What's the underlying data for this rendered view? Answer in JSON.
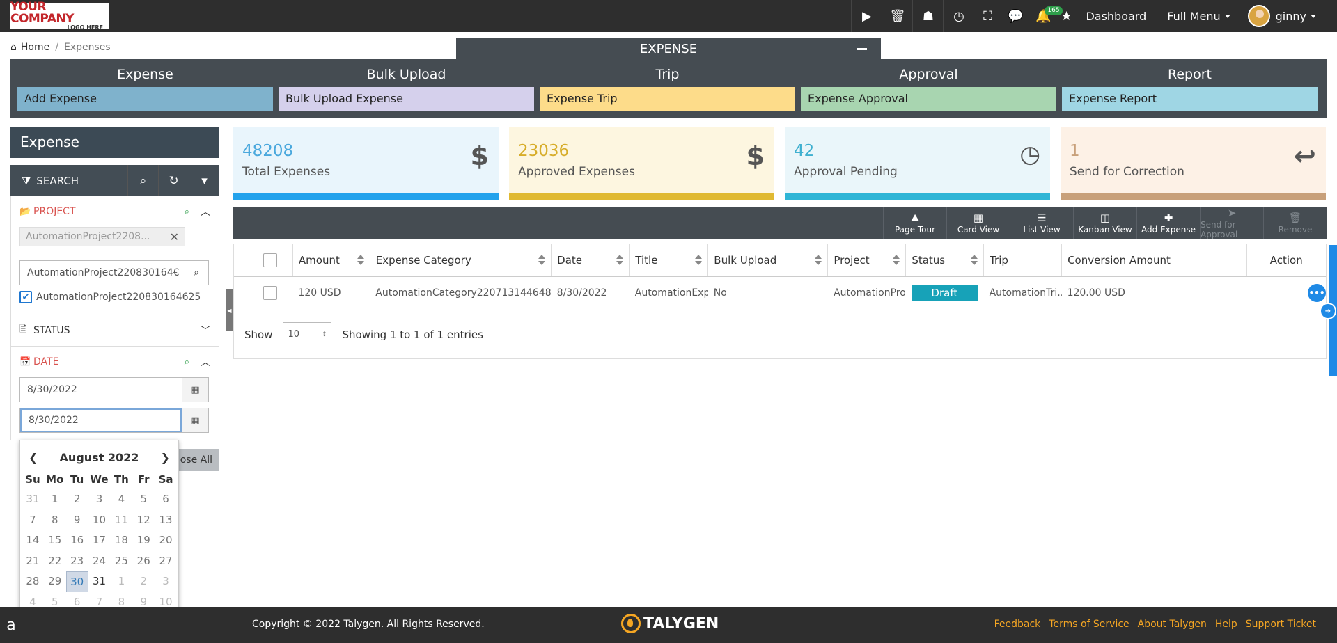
{
  "logo": {
    "line1": "YOUR COMPANY",
    "line2": "LOGO HERE"
  },
  "topnav": {
    "notification_count": "165",
    "dashboard": "Dashboard",
    "full_menu": "Full Menu",
    "user": "ginny"
  },
  "breadcrumb": {
    "home": "Home",
    "current": "Expenses"
  },
  "expense_header": "EXPENSE",
  "modules": [
    {
      "title": "Expense",
      "link": "Add Expense",
      "color": "#7fb2cc"
    },
    {
      "title": "Bulk Upload",
      "link": "Bulk Upload Expense",
      "color": "#d5d0ec"
    },
    {
      "title": "Trip",
      "link": "Expense Trip",
      "color": "#fddc8a"
    },
    {
      "title": "Approval",
      "link": "Expense Approval",
      "color": "#a8d5b0"
    },
    {
      "title": "Report",
      "link": "Expense Report",
      "color": "#9fd6e4"
    }
  ],
  "left_panel": {
    "title": "Expense",
    "search_label": "SEARCH",
    "project": {
      "title": "PROJECT",
      "chip": "AutomationProject2208...",
      "input_value": "AutomationProject220830164€",
      "checked_item": "AutomationProject220830164625"
    },
    "status": {
      "title": "STATUS"
    },
    "date": {
      "title": "DATE",
      "from": "8/30/2022",
      "to": "8/30/2022"
    },
    "close_all": "ose All"
  },
  "datepicker": {
    "month": "August 2022",
    "weekdays": [
      "Su",
      "Mo",
      "Tu",
      "We",
      "Th",
      "Fr",
      "Sa"
    ],
    "weeks": [
      [
        "31",
        "1",
        "2",
        "3",
        "4",
        "5",
        "6"
      ],
      [
        "7",
        "8",
        "9",
        "10",
        "11",
        "12",
        "13"
      ],
      [
        "14",
        "15",
        "16",
        "17",
        "18",
        "19",
        "20"
      ],
      [
        "21",
        "22",
        "23",
        "24",
        "25",
        "26",
        "27"
      ],
      [
        "28",
        "29",
        "30",
        "31",
        "1",
        "2",
        "3"
      ],
      [
        "4",
        "5",
        "6",
        "7",
        "8",
        "9",
        "10"
      ]
    ],
    "selected": "30"
  },
  "stats": [
    {
      "value": "48208",
      "label": "Total Expenses",
      "color": "#e9f5fc",
      "text_color": "#4aa8dd",
      "bar": "#23a2ec"
    },
    {
      "value": "23036",
      "label": "Approved Expenses",
      "color": "#fdf6e0",
      "text_color": "#d7ad2a",
      "bar": "#e0b931"
    },
    {
      "value": "42",
      "label": "Approval Pending",
      "color": "#eaf6fa",
      "text_color": "#3fb0d0",
      "bar": "#2fb5d6"
    },
    {
      "value": "1",
      "label": "Send for Correction",
      "color": "#fdf1e6",
      "text_color": "#c8a07a",
      "bar": "#c8a07a"
    }
  ],
  "toolbar": [
    {
      "label": "Page Tour",
      "icon": "road-icon",
      "glyph": "⛰",
      "enabled": true
    },
    {
      "label": "Card View",
      "icon": "grid-icon",
      "glyph": "▦",
      "enabled": true
    },
    {
      "label": "List View",
      "icon": "list-icon",
      "glyph": "☰",
      "enabled": true
    },
    {
      "label": "Kanban View",
      "icon": "kanban-icon",
      "glyph": "◫",
      "enabled": true
    },
    {
      "label": "Add Expense",
      "icon": "plus-icon",
      "glyph": "✚",
      "enabled": true
    },
    {
      "label": "Send for Approval",
      "icon": "send-icon",
      "glyph": "➤",
      "enabled": false
    },
    {
      "label": "Remove",
      "icon": "trash-icon",
      "glyph": "🗑",
      "enabled": false
    }
  ],
  "table": {
    "columns": [
      "Amount",
      "Expense Category",
      "Date",
      "Title",
      "Bulk Upload",
      "Project",
      "Status",
      "Trip",
      "Conversion Amount",
      "Action"
    ],
    "rows": [
      {
        "amount": "120 USD",
        "category": "AutomationCategory220713144648",
        "date": "8/30/2022",
        "title": "AutomationExp",
        "bulk_upload": "No",
        "project": "AutomationPro",
        "status": "Draft",
        "trip": "AutomationTri...",
        "conversion": "120.00 USD"
      }
    ],
    "show_label": "Show",
    "page_size": "10",
    "info": "Showing 1 to 1 of 1 entries"
  },
  "footer": {
    "copyright": "Copyright © 2022 Talygen. All Rights Reserved.",
    "brand": "TALYGEN",
    "links": [
      "Feedback",
      "Terms of Service",
      "About Talygen",
      "Help",
      "Support Ticket"
    ]
  }
}
